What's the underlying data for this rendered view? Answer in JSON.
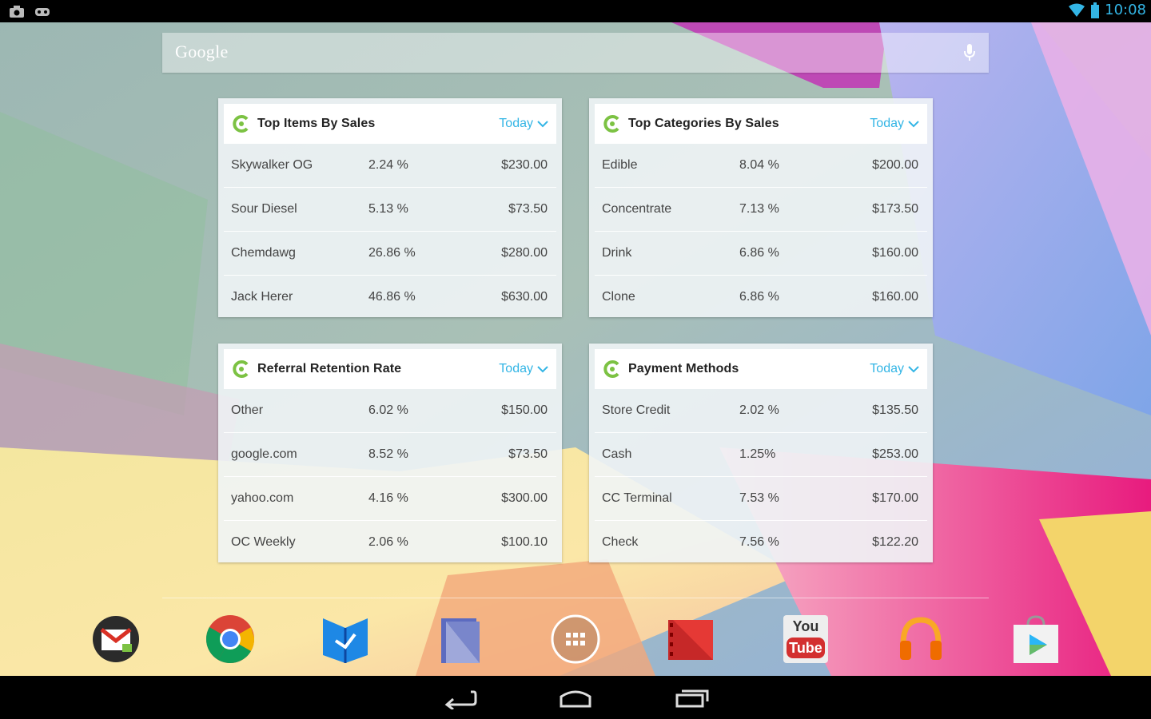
{
  "status_bar": {
    "time": "10:08",
    "left_icons": [
      "camera-icon",
      "controller-icon"
    ],
    "right_icons": [
      "wifi-icon",
      "battery-icon"
    ],
    "accent_color": "#33b5e5"
  },
  "search": {
    "logo_text": "Google",
    "mic_icon": "mic-icon"
  },
  "widgets": [
    {
      "title": "Top Items By Sales",
      "range": "Today",
      "rows": [
        {
          "name": "Skywalker OG",
          "pct": "2.24 %",
          "amount": "$230.00"
        },
        {
          "name": "Sour Diesel",
          "pct": "5.13 %",
          "amount": "$73.50"
        },
        {
          "name": "Chemdawg",
          "pct": "26.86 %",
          "amount": "$280.00"
        },
        {
          "name": "Jack Herer",
          "pct": "46.86 %",
          "amount": "$630.00"
        }
      ]
    },
    {
      "title": "Top Categories By Sales",
      "range": "Today",
      "rows": [
        {
          "name": "Edible",
          "pct": "8.04 %",
          "amount": "$200.00"
        },
        {
          "name": "Concentrate",
          "pct": "7.13 %",
          "amount": "$173.50"
        },
        {
          "name": "Drink",
          "pct": "6.86 %",
          "amount": "$160.00"
        },
        {
          "name": "Clone",
          "pct": "6.86 %",
          "amount": "$160.00"
        }
      ]
    },
    {
      "title": "Referral Retention Rate",
      "range": "Today",
      "rows": [
        {
          "name": "Other",
          "pct": "6.02 %",
          "amount": "$150.00"
        },
        {
          "name": "google.com",
          "pct": "8.52 %",
          "amount": "$73.50"
        },
        {
          "name": "yahoo.com",
          "pct": "4.16 %",
          "amount": "$300.00"
        },
        {
          "name": "OC Weekly",
          "pct": "2.06 %",
          "amount": "$100.10"
        }
      ]
    },
    {
      "title": "Payment Methods",
      "range": "Today",
      "rows": [
        {
          "name": "Store Credit",
          "pct": "2.02 %",
          "amount": "$135.50"
        },
        {
          "name": "Cash",
          "pct": "1.25%",
          "amount": "$253.00"
        },
        {
          "name": "CC Terminal",
          "pct": "7.53 %",
          "amount": "$170.00"
        },
        {
          "name": "Check",
          "pct": "7.56 %",
          "amount": "$122.20"
        }
      ]
    }
  ],
  "dock": [
    {
      "icon": "gmail-icon"
    },
    {
      "icon": "chrome-icon"
    },
    {
      "icon": "play-books-icon"
    },
    {
      "icon": "play-magazines-icon"
    },
    {
      "icon": "all-apps-icon"
    },
    {
      "icon": "play-movies-icon"
    },
    {
      "icon": "youtube-icon",
      "label_top": "You",
      "label_bottom": "Tube"
    },
    {
      "icon": "play-music-icon"
    },
    {
      "icon": "play-store-icon"
    }
  ],
  "nav_bar": {
    "buttons": [
      "back-icon",
      "home-icon",
      "recents-icon"
    ]
  },
  "colors": {
    "today_link": "#33b5e5",
    "logo_green": "#7cc243"
  }
}
